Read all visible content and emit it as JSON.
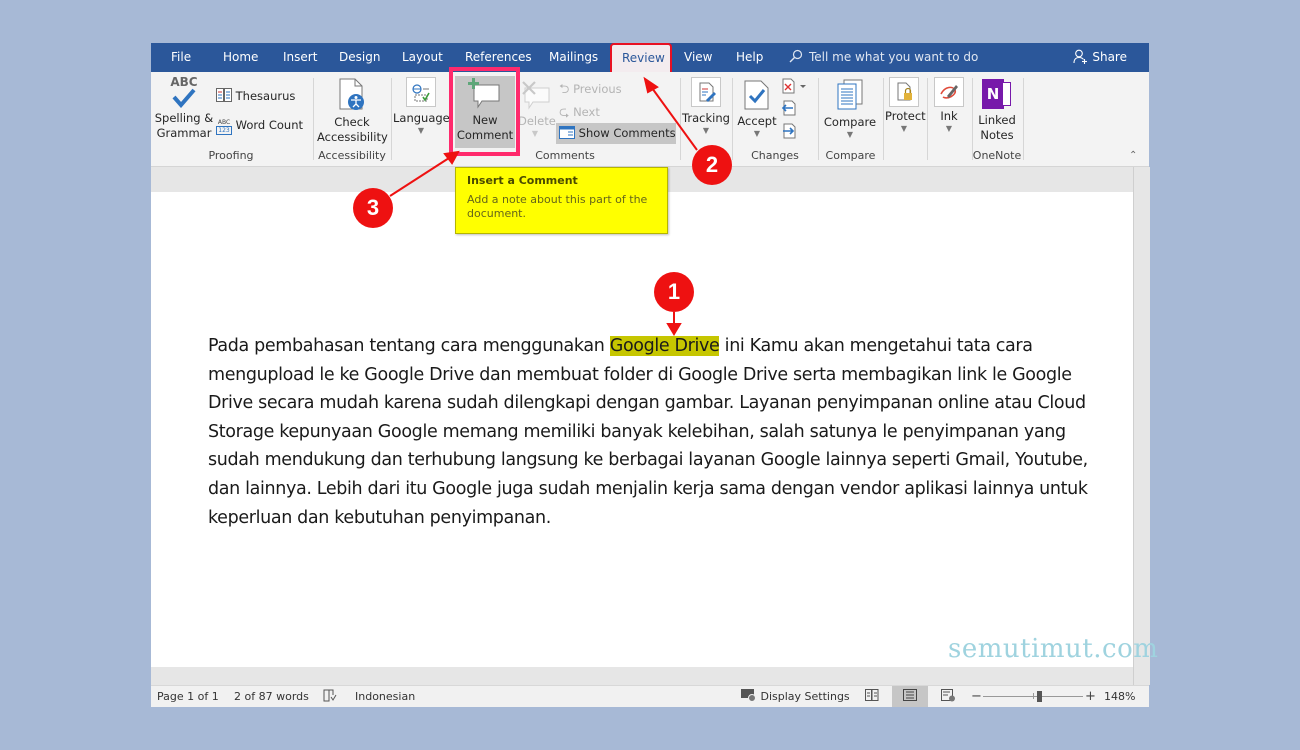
{
  "menubar": {
    "tabs": [
      {
        "label": "File"
      },
      {
        "label": "Home"
      },
      {
        "label": "Insert"
      },
      {
        "label": "Design"
      },
      {
        "label": "Layout"
      },
      {
        "label": "References"
      },
      {
        "label": "Mailings"
      },
      {
        "label": "Review",
        "active": true
      },
      {
        "label": "View"
      },
      {
        "label": "Help"
      }
    ],
    "tell_me": "Tell me what you want to do",
    "share": "Share"
  },
  "ribbon": {
    "proofing": {
      "spelling_line1": "Spelling &",
      "spelling_line2": "Grammar",
      "spelling_icon_text": "ABC",
      "thesaurus": "Thesaurus",
      "word_count": "Word Count",
      "word_count_icon_top": "ABC",
      "word_count_icon_bottom": "123",
      "group": "Proofing"
    },
    "accessibility": {
      "check_line1": "Check",
      "check_line2": "Accessibility",
      "group": "Accessibility"
    },
    "language": {
      "label": "Language"
    },
    "comments": {
      "new_line1": "New",
      "new_line2": "Comment",
      "delete": "Delete",
      "previous": "Previous",
      "next": "Next",
      "show_comments": "Show Comments",
      "group": "Comments"
    },
    "tracking": {
      "label": "Tracking"
    },
    "changes": {
      "accept": "Accept",
      "group": "Changes"
    },
    "compare": {
      "label": "Compare",
      "group": "Compare"
    },
    "protect": {
      "label": "Protect"
    },
    "ink": {
      "label": "Ink"
    },
    "onenote": {
      "line1": "Linked",
      "line2": "Notes",
      "icon_letter": "N",
      "group": "OneNote"
    }
  },
  "tooltip": {
    "title": "Insert a Comment",
    "body": "Add a note about this part of the document."
  },
  "document": {
    "before_highlight": "Pada pembahasan tentang cara menggunakan ",
    "highlight": "Google Drive",
    "after_highlight": " ini Kamu akan mengetahui tata cara mengupload le ke Google Drive dan membuat folder di Google Drive serta membagikan link le Google Drive secara mudah karena sudah dilengkapi dengan gambar. Layanan penyimpanan online atau Cloud Storage kepunyaan Google memang memiliki banyak kelebihan, salah satunya le penyimpanan yang sudah mendukung dan terhubung langsung ke berbagai layanan Google lainnya seperti Gmail, Youtube, dan lainnya. Lebih dari itu Google juga sudah menjalin kerja sama dengan vendor aplikasi lainnya untuk keperluan dan kebutuhan penyimpanan."
  },
  "annotations": {
    "step1": "1",
    "step2": "2",
    "step3": "3",
    "watermark": "semutimut.com",
    "color": "#ee1111",
    "box_color": "#ff2a6d"
  },
  "statusbar": {
    "page": "Page 1 of 1",
    "words": "2 of 87 words",
    "language": "Indonesian",
    "display_settings": "Display Settings",
    "zoom_minus": "−",
    "zoom_plus": "+",
    "zoom_level": "148%",
    "zoom_percent": 148
  }
}
